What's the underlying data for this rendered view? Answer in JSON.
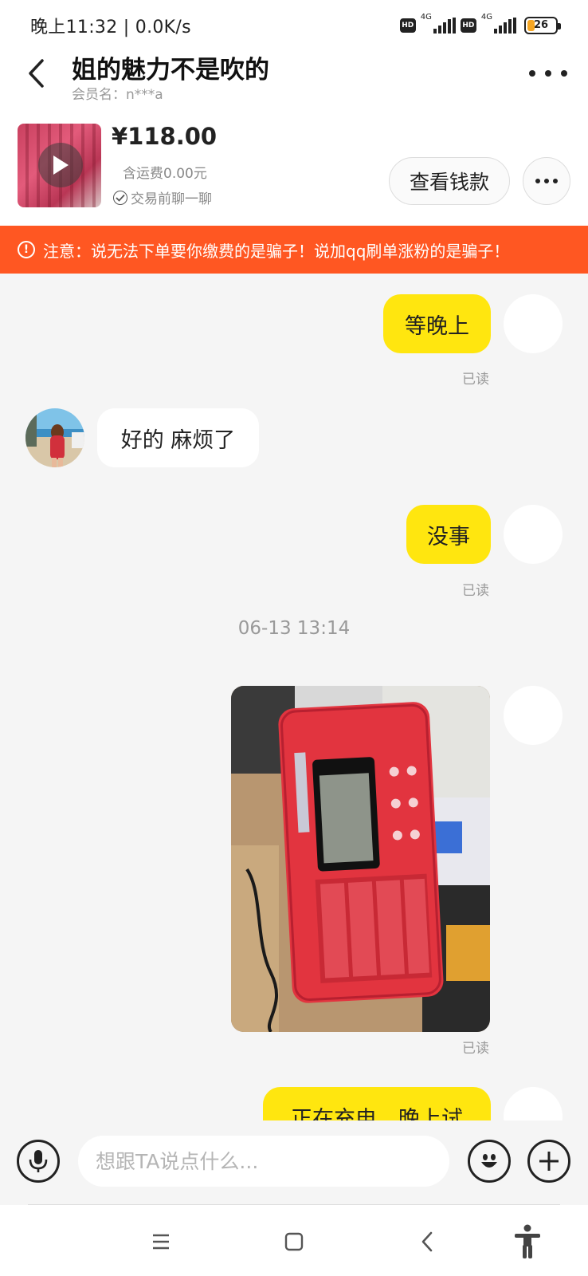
{
  "status_bar": {
    "time": "晚上11:32 | 0.0K/s",
    "hd1": "HD",
    "hd2": "HD",
    "net1": "4G",
    "net2": "4G",
    "battery": "26",
    "battery_level": 0.26,
    "battery_color": "#f5a623"
  },
  "header": {
    "title": "姐的魅力不是吹的",
    "subtitle": "会员名：n***a",
    "back_icon": "chevron-left-icon",
    "more_icon": "more-horizontal-icon"
  },
  "product": {
    "price": "¥118.00",
    "shipping": "含运费0.00元",
    "chat_first": "交易前聊一聊",
    "view_button": "查看钱款"
  },
  "warning": {
    "text": "注意：说无法下单要你缴费的是骗子！说加qq刷单涨粉的是骗子！",
    "color": "#ff5722"
  },
  "chat": {
    "messages": [
      {
        "from": "me",
        "text": "等晚上",
        "status": "已读"
      },
      {
        "from": "other",
        "text": "好的 麻烦了"
      },
      {
        "from": "me",
        "text": "没事",
        "status": "已读"
      },
      {
        "timestamp": "06-13 13:14"
      },
      {
        "from": "me",
        "type": "image",
        "status": "已读"
      },
      {
        "from": "me",
        "text": "正在充电，晚上试"
      }
    ],
    "colors": {
      "mine": "#ffe60f",
      "theirs": "#ffffff"
    }
  },
  "input": {
    "placeholder": "想跟TA说点什么...",
    "voice_icon": "microphone-icon",
    "emoji_icon": "emoji-icon",
    "plus_icon": "plus-icon"
  },
  "nav": {
    "icons": [
      "menu-icon",
      "home-icon",
      "back-icon",
      "accessibility-icon"
    ]
  }
}
